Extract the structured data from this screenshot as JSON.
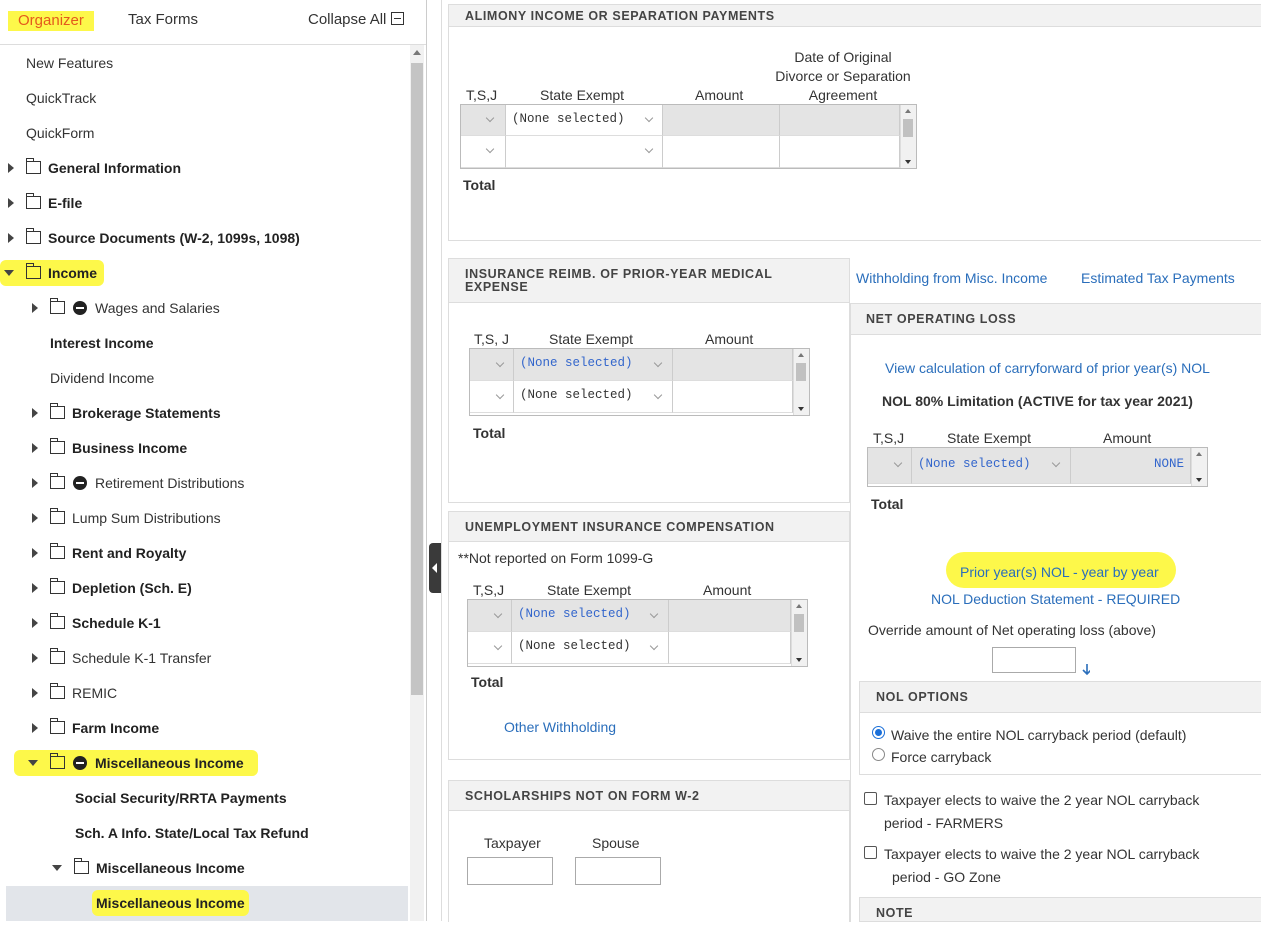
{
  "sidebar": {
    "tabs": {
      "organizer": "Organizer",
      "tax_forms": "Tax Forms",
      "collapse_all": "Collapse All"
    },
    "items": [
      {
        "label": "New Features"
      },
      {
        "label": "QuickTrack"
      },
      {
        "label": "QuickForm"
      },
      {
        "label": "General Information"
      },
      {
        "label": "E-file"
      },
      {
        "label": "Source Documents (W-2, 1099s, 1098)"
      },
      {
        "label": "Income"
      },
      {
        "label": "Wages and Salaries"
      },
      {
        "label": "Interest Income"
      },
      {
        "label": "Dividend Income"
      },
      {
        "label": "Brokerage Statements"
      },
      {
        "label": "Business Income"
      },
      {
        "label": "Retirement Distributions"
      },
      {
        "label": "Lump Sum Distributions"
      },
      {
        "label": "Rent and Royalty"
      },
      {
        "label": "Depletion (Sch. E)"
      },
      {
        "label": "Schedule K-1"
      },
      {
        "label": "Schedule K-1 Transfer"
      },
      {
        "label": "REMIC"
      },
      {
        "label": "Farm Income"
      },
      {
        "label": "Miscellaneous Income"
      },
      {
        "label": "Social Security/RRTA Payments"
      },
      {
        "label": "Sch. A Info. State/Local Tax Refund"
      },
      {
        "label": "Miscellaneous Income"
      },
      {
        "label": "Miscellaneous Income"
      }
    ]
  },
  "alimony": {
    "title": "ALIMONY INCOME OR SEPARATION PAYMENTS",
    "col_tsj": "T,S,J",
    "col_state": "State Exempt",
    "col_amount": "Amount",
    "col_date_l1": "Date of Original",
    "col_date_l2": "Divorce or Separation",
    "col_date_l3": "Agreement",
    "row1_state": "(None selected)",
    "total": "Total"
  },
  "insurance": {
    "title_l1": "INSURANCE REIMB. OF PRIOR-YEAR MEDICAL",
    "title_l2": "EXPENSE",
    "col_tsj": "T,S, J",
    "col_state": "State Exempt",
    "col_amount": "Amount",
    "row1_state": "(None selected)",
    "row2_state": "(None selected)",
    "total": "Total"
  },
  "links_top": {
    "withholding": "Withholding from Misc. Income",
    "estimated": "Estimated Tax Payments"
  },
  "unemployment": {
    "title": "UNEMPLOYMENT INSURANCE COMPENSATION",
    "note": "**Not reported on Form 1099-G",
    "col_tsj": "T,S,J",
    "col_state": "State Exempt",
    "col_amount": "Amount",
    "row1_state": "(None selected)",
    "row2_state": "(None selected)",
    "total": "Total",
    "other_withholding": "Other Withholding"
  },
  "scholarships": {
    "title": "SCHOLARSHIPS NOT ON FORM W-2",
    "col_taxpayer": "Taxpayer",
    "col_spouse": "Spouse"
  },
  "nol": {
    "title": "NET OPERATING LOSS",
    "view_calc": "View calculation of carryforward of prior year(s) NOL",
    "limitation": "NOL 80% Limitation (ACTIVE for tax year 2021)",
    "col_tsj": "T,S,J",
    "col_state": "State Exempt",
    "col_amount": "Amount",
    "row1_state": "(None selected)",
    "row1_amount": "NONE",
    "total": "Total",
    "prior_year": "Prior year(s) NOL - year by year",
    "deduction_stmt": "NOL Deduction Statement - REQUIRED",
    "override_label": "Override amount of Net operating loss (above)",
    "override_value": ""
  },
  "nol_options": {
    "title": "NOL OPTIONS",
    "opt_waive": "Waive the entire NOL carryback period (default)",
    "opt_force": "Force carryback",
    "farmers_l1": "Taxpayer elects to waive the 2 year NOL carryback",
    "farmers_l2": "period - FARMERS",
    "gozone_l1": "Taxpayer elects to waive the 2 year NOL carryback",
    "gozone_l2": "period - GO Zone"
  },
  "note": {
    "title": "NOTE"
  }
}
